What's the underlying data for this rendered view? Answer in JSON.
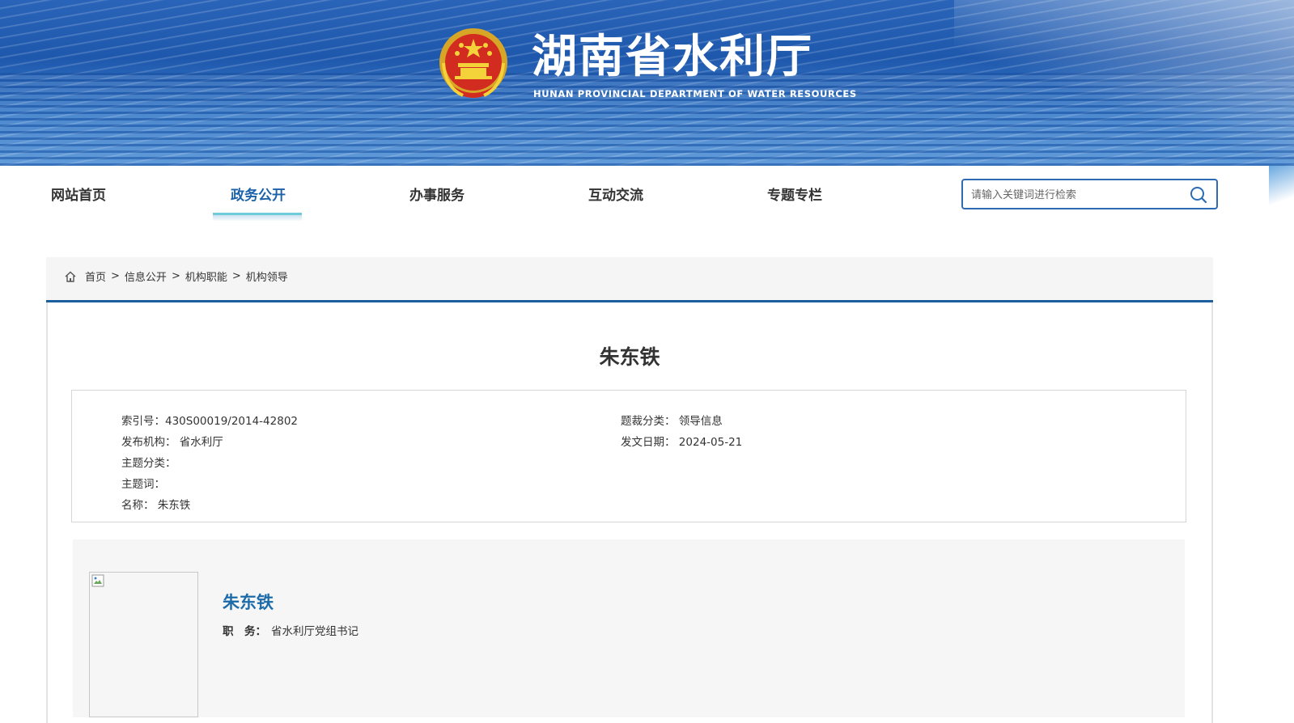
{
  "header": {
    "title": "湖南省水利厅",
    "subtitle": "HUNAN PROVINCIAL DEPARTMENT OF WATER RESOURCES"
  },
  "nav": {
    "items": [
      {
        "label": "网站首页",
        "active": false
      },
      {
        "label": "政务公开",
        "active": true
      },
      {
        "label": "办事服务",
        "active": false
      },
      {
        "label": "互动交流",
        "active": false
      },
      {
        "label": "专题专栏",
        "active": false
      }
    ],
    "search": {
      "placeholder": "请输入关键词进行检索",
      "value": ""
    }
  },
  "breadcrumb": {
    "items": [
      "首页",
      "信息公开",
      "机构职能",
      "机构领导"
    ],
    "separator": ">"
  },
  "article": {
    "title": "朱东铁",
    "meta": {
      "index_label": "索引号：",
      "index_value": "430S00019/2014-42802",
      "publisher_label": "发布机构：",
      "publisher_value": "省水利厅",
      "topic_label": "主题分类：",
      "topic_value": "",
      "keywords_label": "主题词：",
      "keywords_value": "",
      "name_label": "名称：",
      "name_value": "朱东铁",
      "genre_label": "题裁分类：",
      "genre_value": "领导信息",
      "date_label": "发文日期：",
      "date_value": "2024-05-21"
    }
  },
  "profile": {
    "name": "朱东铁",
    "role_label": "职　务：",
    "role_value": "省水利厅党组书记"
  },
  "colors": {
    "accent": "#1c62aa",
    "banner": "#2a64b8",
    "crumb_line": "#1d5e9e",
    "profile_name": "#1d6ba8"
  }
}
